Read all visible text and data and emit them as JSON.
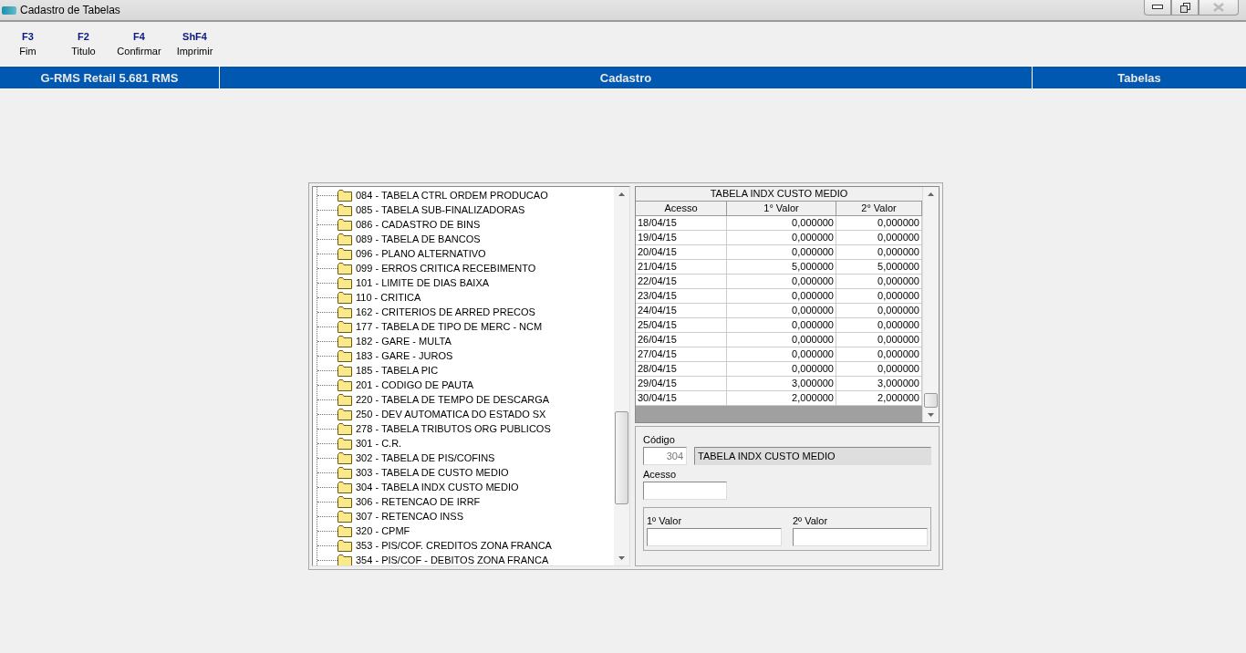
{
  "window": {
    "title": "Cadastro de Tabelas"
  },
  "toolbar": [
    {
      "key": "F3",
      "label": "Fim"
    },
    {
      "key": "F2",
      "label": "Titulo"
    },
    {
      "key": "F4",
      "label": "Confirmar"
    },
    {
      "key": "ShF4",
      "label": "Imprimir"
    }
  ],
  "header_bar": {
    "system": "G-RMS Retail 5.681 RMS",
    "module": "Cadastro",
    "screen": "Tabelas"
  },
  "tree": [
    {
      "label": "084 - TABELA CTRL ORDEM PRODUCAO"
    },
    {
      "label": "085 - TABELA SUB-FINALIZADORAS"
    },
    {
      "label": "086 - CADASTRO DE BINS"
    },
    {
      "label": "089 - TABELA DE BANCOS"
    },
    {
      "label": "096 - PLANO ALTERNATIVO"
    },
    {
      "label": "099 - ERROS CRITICA RECEBIMENTO"
    },
    {
      "label": "101 - LIMITE DE DIAS BAIXA"
    },
    {
      "label": "110 - CRITICA"
    },
    {
      "label": "162 - CRITERIOS DE ARRED PRECOS"
    },
    {
      "label": "177 - TABELA DE TIPO DE MERC - NCM"
    },
    {
      "label": "182 - GARE - MULTA"
    },
    {
      "label": "183 - GARE - JUROS"
    },
    {
      "label": "185 - TABELA PIC"
    },
    {
      "label": "201 - CODIGO DE PAUTA"
    },
    {
      "label": "220 - TABELA DE TEMPO DE DESCARGA"
    },
    {
      "label": "250 - DEV AUTOMATICA DO ESTADO SX"
    },
    {
      "label": "278 - TABELA TRIBUTOS ORG PUBLICOS"
    },
    {
      "label": "301 - C.R."
    },
    {
      "label": "302 - TABELA DE PIS/COFINS"
    },
    {
      "label": "303 - TABELA DE CUSTO MEDIO"
    },
    {
      "label": "304 - TABELA INDX CUSTO MEDIO"
    },
    {
      "label": "306 - RETENCAO DE IRRF"
    },
    {
      "label": "307 - RETENCAO INSS"
    },
    {
      "label": "320 - CPMF"
    },
    {
      "label": "353 - PIS/COF. CREDITOS ZONA FRANCA"
    },
    {
      "label": "354 - PIS/COF - DEBITOS ZONA FRANCA"
    }
  ],
  "grid": {
    "caption": "TABELA INDX CUSTO MEDIO",
    "columns": [
      "Acesso",
      "1° Valor",
      "2° Valor"
    ],
    "rows": [
      [
        "18/04/15",
        "0,000000",
        "0,000000"
      ],
      [
        "19/04/15",
        "0,000000",
        "0,000000"
      ],
      [
        "20/04/15",
        "0,000000",
        "0,000000"
      ],
      [
        "21/04/15",
        "5,000000",
        "5,000000"
      ],
      [
        "22/04/15",
        "0,000000",
        "0,000000"
      ],
      [
        "23/04/15",
        "0,000000",
        "0,000000"
      ],
      [
        "24/04/15",
        "0,000000",
        "0,000000"
      ],
      [
        "25/04/15",
        "0,000000",
        "0,000000"
      ],
      [
        "26/04/15",
        "0,000000",
        "0,000000"
      ],
      [
        "27/04/15",
        "0,000000",
        "0,000000"
      ],
      [
        "28/04/15",
        "0,000000",
        "0,000000"
      ],
      [
        "29/04/15",
        "3,000000",
        "3,000000"
      ],
      [
        "30/04/15",
        "2,000000",
        "2,000000"
      ]
    ]
  },
  "form": {
    "codigo_label": "Código",
    "codigo_value": "304",
    "nome_value": "TABELA INDX CUSTO MEDIO",
    "acesso_label": "Acesso",
    "valor1_label": "1º Valor",
    "valor2_label": "2º Valor"
  }
}
